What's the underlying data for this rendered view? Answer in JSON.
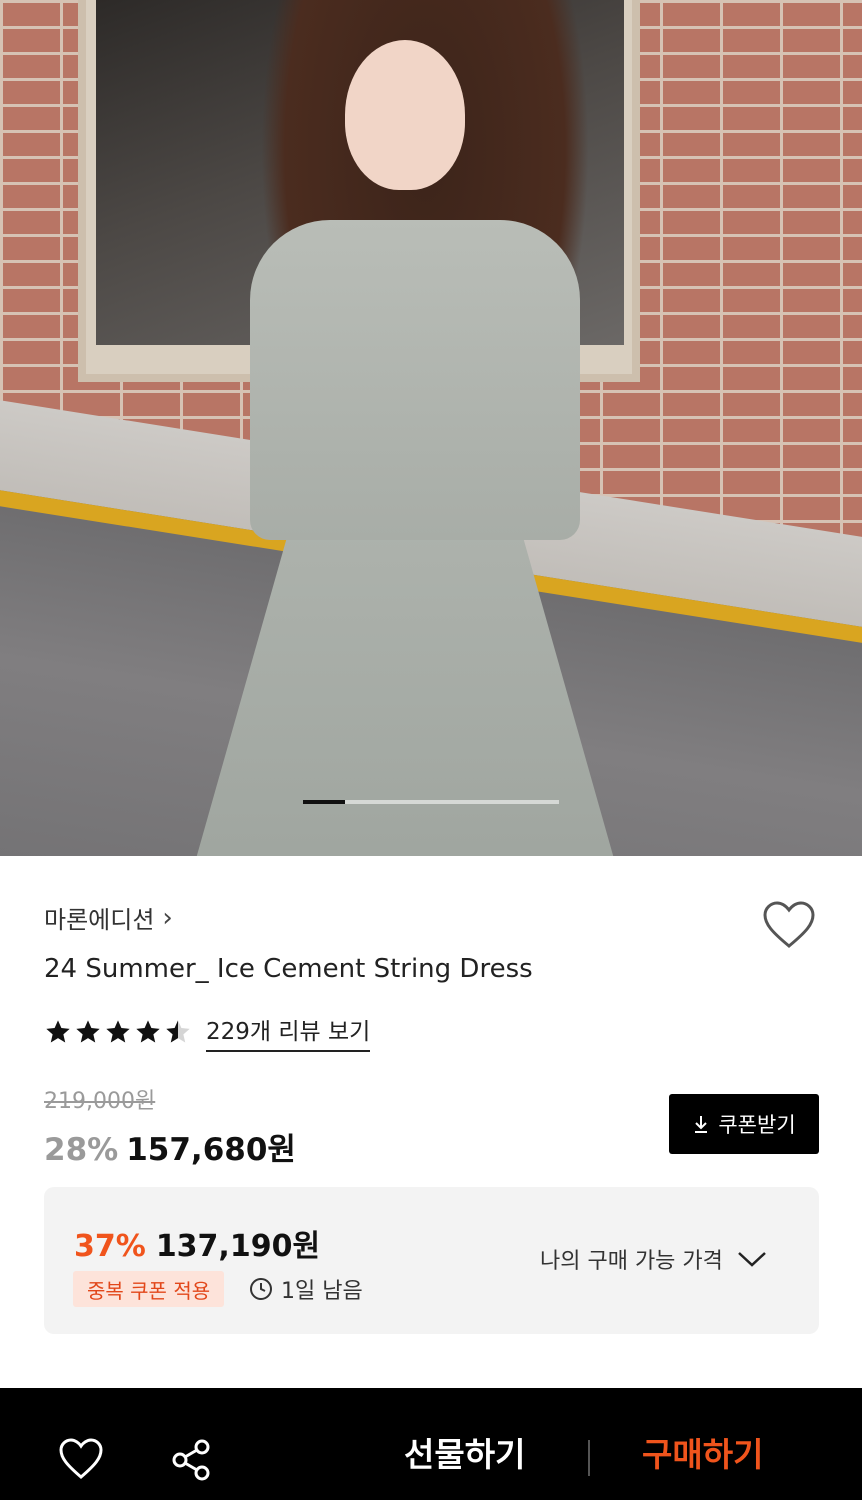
{
  "product_image": {
    "alt": "",
    "carousel_indicator": {
      "current": 1,
      "total": 6
    }
  },
  "product": {
    "brand": "마론에디션",
    "brand_chevron": "›",
    "title": "24 Summer_ Ice Cement String Dress",
    "rating": 4.5,
    "review_link": "229개 리뷰 보기"
  },
  "pricing": {
    "original_price": "219,000원",
    "discount_rate": "28%",
    "sale_price": "157,680원",
    "coupon_button": "쿠폰받기"
  },
  "benefit": {
    "discount_rate": "37%",
    "price": "137,190원",
    "tag": "중복 쿠폰 적용",
    "time_left": "1일 남음",
    "expand_label": "나의 구매 가능 가격"
  },
  "bottom_bar": {
    "gift_button": "선물하기",
    "buy_button": "구매하기"
  },
  "colors": {
    "accent": "#f0541c",
    "accent_bg": "#fde3da",
    "muted": "#9a9a9a"
  },
  "icons": {
    "favorite": "heart-icon",
    "share": "share-icon",
    "download": "download-icon",
    "clock": "clock-icon",
    "expand": "chevron-down-icon"
  }
}
